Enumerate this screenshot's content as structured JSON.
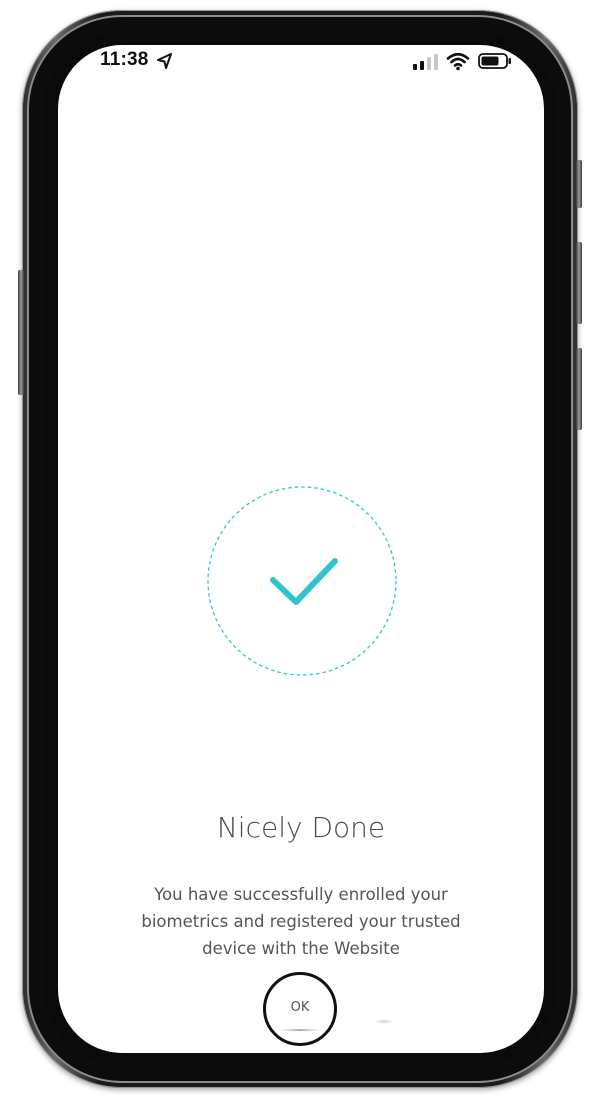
{
  "status_bar": {
    "time": "11:38",
    "location_icon": "location-arrow-icon",
    "signal_icon": "cellular-signal-icon",
    "wifi_icon": "wifi-icon",
    "battery_icon": "battery-icon"
  },
  "success": {
    "icon": "checkmark-icon",
    "accent_color": "#2fc4cc"
  },
  "content": {
    "title": "Nicely Done",
    "message": "You have successfully enrolled your biometrics and registered your trusted device with the Website"
  },
  "actions": {
    "ok_label": "OK"
  }
}
